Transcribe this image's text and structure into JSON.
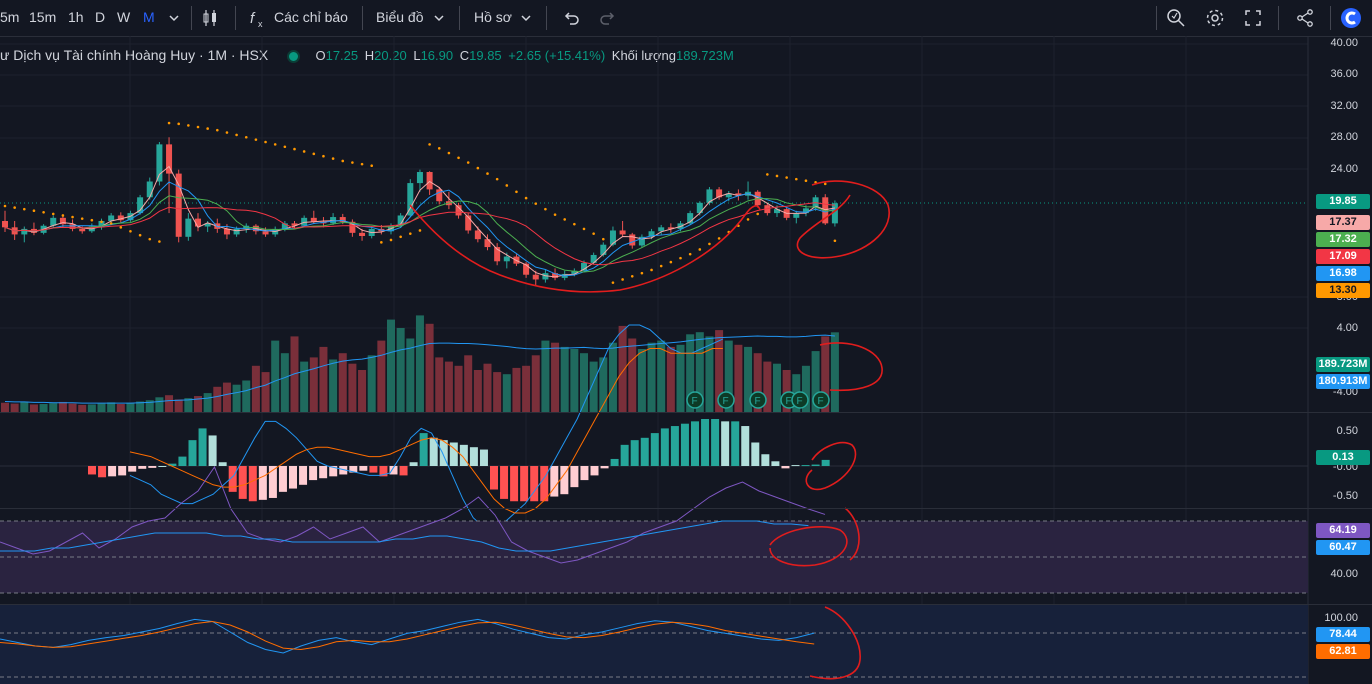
{
  "toolbar": {
    "intervals": [
      "5m",
      "15m",
      "1h",
      "D",
      "W",
      "M"
    ],
    "active_interval": "M",
    "indicators_label": "Các chỉ báo",
    "chart_label": "Biểu đồ",
    "profile_label": "Hồ sơ"
  },
  "legend": {
    "symbol": "ư Dịch vụ Tài chính Hoàng Huy · 1M · HSX",
    "o_label": "O",
    "o_value": "17.25",
    "h_label": "H",
    "h_value": "20.20",
    "l_label": "L",
    "l_value": "16.90",
    "c_label": "C",
    "c_value": "19.85",
    "change": "+2.65 (+15.41%)",
    "volume_label": "Khối lượng",
    "volume_value": "189.723M"
  },
  "price_axis": [
    "40.00",
    "36.00",
    "32.00",
    "28.00",
    "24.00",
    "8.00",
    "4.00",
    "-4.00"
  ],
  "price_tags": [
    {
      "value": "19.85",
      "bg": "#089981",
      "fg": "#ffffff"
    },
    {
      "value": "17.37",
      "bg": "#f7a9a8",
      "fg": "#131722"
    },
    {
      "value": "17.32",
      "bg": "#4caf50",
      "fg": "#ffffff"
    },
    {
      "value": "17.09",
      "bg": "#f23645",
      "fg": "#ffffff"
    },
    {
      "value": "16.98",
      "bg": "#2196f3",
      "fg": "#ffffff"
    },
    {
      "value": "13.30",
      "bg": "#ff9800",
      "fg": "#131722"
    }
  ],
  "volume_tags": [
    {
      "value": "189.723M",
      "bg": "#089981",
      "fg": "#ffffff"
    },
    {
      "value": "180.913M",
      "bg": "#2196f3",
      "fg": "#ffffff"
    }
  ],
  "macd_axis": [
    "0.50",
    "-0.00",
    "-0.50"
  ],
  "macd_tag": {
    "value": "0.13",
    "bg": "#089981",
    "fg": "#ffffff"
  },
  "rsi_axis": [
    "40.00"
  ],
  "rsi_tags": [
    {
      "value": "64.19",
      "bg": "#7e57c2",
      "fg": "#ffffff"
    },
    {
      "value": "60.47",
      "bg": "#2196f3",
      "fg": "#ffffff"
    }
  ],
  "stoch_axis": [
    "100.00"
  ],
  "stoch_tags": [
    {
      "value": "78.44",
      "bg": "#2196f3",
      "fg": "#ffffff"
    },
    {
      "value": "62.81",
      "bg": "#ff6d00",
      "fg": "#ffffff"
    }
  ],
  "event_marker": "F",
  "colors": {
    "up": "#26a69a",
    "down": "#ef5350",
    "vol_up": "#1f6a5e",
    "vol_down": "#7a2f3a",
    "accent": "#2962ff"
  },
  "chart_data": {
    "type": "candlestick",
    "candles": [
      [
        17.6,
        18.9,
        16.2,
        16.8
      ],
      [
        16.8,
        17.6,
        15.2,
        15.9
      ],
      [
        15.9,
        16.9,
        14.9,
        16.6
      ],
      [
        16.6,
        17.4,
        15.8,
        16.1
      ],
      [
        16.1,
        17.2,
        15.9,
        17.0
      ],
      [
        17.0,
        18.3,
        16.7,
        18.0
      ],
      [
        18.0,
        18.2,
        16.8,
        17.2
      ],
      [
        17.2,
        17.8,
        16.3,
        16.6
      ],
      [
        16.6,
        16.9,
        16.0,
        16.3
      ],
      [
        16.3,
        17.3,
        16.1,
        16.9
      ],
      [
        16.9,
        17.9,
        16.5,
        17.6
      ],
      [
        17.6,
        18.6,
        17.2,
        18.3
      ],
      [
        18.3,
        18.7,
        17.3,
        17.7
      ],
      [
        17.7,
        18.9,
        17.5,
        18.6
      ],
      [
        18.6,
        20.9,
        18.4,
        20.6
      ],
      [
        20.6,
        23.1,
        20.3,
        22.6
      ],
      [
        22.6,
        27.6,
        22.1,
        27.3
      ],
      [
        27.3,
        28.2,
        18.6,
        23.6
      ],
      [
        23.6,
        24.1,
        14.9,
        15.6
      ],
      [
        15.6,
        18.6,
        15.1,
        17.9
      ],
      [
        17.9,
        18.6,
        16.3,
        16.9
      ],
      [
        16.9,
        17.6,
        16.2,
        17.3
      ],
      [
        17.3,
        17.9,
        16.1,
        16.6
      ],
      [
        16.6,
        17.2,
        15.3,
        15.9
      ],
      [
        15.9,
        16.9,
        15.6,
        16.6
      ],
      [
        16.6,
        17.3,
        16.1,
        17.0
      ],
      [
        17.0,
        17.2,
        15.9,
        16.3
      ],
      [
        16.3,
        16.8,
        15.6,
        15.9
      ],
      [
        15.9,
        16.9,
        15.6,
        16.6
      ],
      [
        16.6,
        17.6,
        16.3,
        17.3
      ],
      [
        17.3,
        17.6,
        16.6,
        17.0
      ],
      [
        17.0,
        18.3,
        16.8,
        18.0
      ],
      [
        18.0,
        18.9,
        17.3,
        17.5
      ],
      [
        17.5,
        18.1,
        16.8,
        17.3
      ],
      [
        17.3,
        18.6,
        17.1,
        18.1
      ],
      [
        18.1,
        18.5,
        17.2,
        17.5
      ],
      [
        17.5,
        17.8,
        15.6,
        16.1
      ],
      [
        16.1,
        16.6,
        15.1,
        15.7
      ],
      [
        15.7,
        16.9,
        15.4,
        16.6
      ],
      [
        16.6,
        17.1,
        15.9,
        16.3
      ],
      [
        16.3,
        17.3,
        15.9,
        17.0
      ],
      [
        17.0,
        18.6,
        16.8,
        18.3
      ],
      [
        18.3,
        22.9,
        18.1,
        22.4
      ],
      [
        22.4,
        24.1,
        21.3,
        23.8
      ],
      [
        23.8,
        23.9,
        20.9,
        21.6
      ],
      [
        21.6,
        21.9,
        19.7,
        20.1
      ],
      [
        20.1,
        21.3,
        19.1,
        19.6
      ],
      [
        19.6,
        19.9,
        17.9,
        18.3
      ],
      [
        18.3,
        18.6,
        16.0,
        16.4
      ],
      [
        16.4,
        16.9,
        14.9,
        15.3
      ],
      [
        15.3,
        15.9,
        13.9,
        14.3
      ],
      [
        14.3,
        14.8,
        12.0,
        12.5
      ],
      [
        12.5,
        13.6,
        11.6,
        13.1
      ],
      [
        13.1,
        13.4,
        11.9,
        12.2
      ],
      [
        12.2,
        12.4,
        10.4,
        10.8
      ],
      [
        10.8,
        11.3,
        9.5,
        10.2
      ],
      [
        10.2,
        11.4,
        9.8,
        11.0
      ],
      [
        11.0,
        11.6,
        10.1,
        10.4
      ],
      [
        10.4,
        11.3,
        10.1,
        10.9
      ],
      [
        10.9,
        11.6,
        10.6,
        11.3
      ],
      [
        11.3,
        12.6,
        11.1,
        12.3
      ],
      [
        12.3,
        13.6,
        12.1,
        13.3
      ],
      [
        13.3,
        14.9,
        13.1,
        14.6
      ],
      [
        14.6,
        16.9,
        14.4,
        16.4
      ],
      [
        16.4,
        17.6,
        15.6,
        15.9
      ],
      [
        15.9,
        16.1,
        14.1,
        14.5
      ],
      [
        14.5,
        15.9,
        14.2,
        15.6
      ],
      [
        15.6,
        16.6,
        15.3,
        16.3
      ],
      [
        16.3,
        17.1,
        15.8,
        16.8
      ],
      [
        16.8,
        17.3,
        16.1,
        16.6
      ],
      [
        16.6,
        17.6,
        16.3,
        17.3
      ],
      [
        17.3,
        18.9,
        17.1,
        18.6
      ],
      [
        18.6,
        20.1,
        18.3,
        19.9
      ],
      [
        19.9,
        21.9,
        19.6,
        21.6
      ],
      [
        21.6,
        21.9,
        20.3,
        20.6
      ],
      [
        20.6,
        21.4,
        20.1,
        21.1
      ],
      [
        21.1,
        21.6,
        20.2,
        20.8
      ],
      [
        20.8,
        22.6,
        20.3,
        21.3
      ],
      [
        21.3,
        21.5,
        19.3,
        19.6
      ],
      [
        19.6,
        19.9,
        18.3,
        18.6
      ],
      [
        18.6,
        19.6,
        18.1,
        19.1
      ],
      [
        19.1,
        19.3,
        17.7,
        18.0
      ],
      [
        18.0,
        18.9,
        17.3,
        18.6
      ],
      [
        18.6,
        19.6,
        18.2,
        19.2
      ],
      [
        19.2,
        20.9,
        18.9,
        20.6
      ],
      [
        20.6,
        21.0,
        17.1,
        17.3
      ],
      [
        17.3,
        20.2,
        16.9,
        19.85
      ]
    ],
    "psar": [
      19.5,
      19.3,
      19.1,
      18.9,
      18.7,
      18.5,
      18.3,
      18.1,
      17.9,
      17.7,
      17.5,
      17.3,
      16.8,
      16.3,
      15.8,
      15.3,
      15.0,
      30.0,
      29.9,
      29.7,
      29.5,
      29.3,
      29.1,
      28.8,
      28.5,
      28.2,
      27.9,
      27.6,
      27.3,
      27.0,
      26.7,
      26.4,
      26.1,
      25.8,
      25.5,
      25.2,
      25.0,
      24.8,
      24.6,
      14.9,
      15.2,
      15.6,
      16.0,
      16.4,
      27.3,
      26.8,
      26.2,
      25.6,
      25.0,
      24.3,
      23.6,
      22.9,
      22.1,
      21.3,
      20.5,
      19.8,
      19.1,
      18.4,
      17.8,
      17.2,
      16.6,
      16.0,
      15.3,
      9.8,
      10.2,
      10.6,
      11.0,
      11.4,
      11.9,
      12.4,
      12.9,
      13.4,
      14.0,
      14.7,
      15.4,
      16.2,
      17.0,
      17.8,
      18.5,
      23.5,
      23.3,
      23.1,
      22.9,
      22.7,
      22.5,
      22.3,
      15.1
    ],
    "volume_M": [
      22,
      20,
      25,
      18,
      19,
      21,
      24,
      20,
      17,
      18,
      20,
      23,
      19,
      22,
      25,
      28,
      35,
      40,
      30,
      33,
      38,
      45,
      60,
      70,
      65,
      75,
      110,
      95,
      170,
      140,
      180,
      120,
      130,
      155,
      125,
      140,
      115,
      100,
      135,
      170,
      220,
      200,
      175,
      230,
      210,
      130,
      120,
      110,
      135,
      100,
      115,
      95,
      90,
      105,
      110,
      135,
      170,
      165,
      155,
      150,
      140,
      120,
      130,
      165,
      205,
      175,
      150,
      165,
      170,
      155,
      160,
      185,
      190,
      180,
      195,
      170,
      160,
      155,
      140,
      120,
      115,
      100,
      90,
      110,
      145,
      180,
      189.723
    ],
    "volume_ma_M": [
      25,
      24,
      24,
      23,
      23,
      22,
      22,
      22,
      21,
      21,
      21,
      21,
      21,
      21,
      22,
      23,
      25,
      27,
      28,
      29,
      31,
      33,
      37,
      42,
      46,
      51,
      58,
      64,
      74,
      82,
      91,
      97,
      103,
      110,
      116,
      121,
      124,
      126,
      130,
      135,
      142,
      148,
      152,
      158,
      163,
      164,
      164,
      163,
      163,
      162,
      160,
      158,
      156,
      153,
      151,
      150,
      151,
      152,
      152,
      153,
      154,
      152,
      151,
      152,
      155,
      157,
      159,
      161,
      163,
      165,
      167,
      170,
      173,
      175,
      177,
      178,
      179,
      180,
      181,
      180,
      180,
      179,
      179,
      180,
      182,
      183,
      180.913
    ],
    "macd": {
      "histogram": [
        -0.18,
        -0.24,
        -0.22,
        -0.2,
        -0.12,
        -0.06,
        -0.04,
        0.0,
        0.05,
        0.2,
        0.55,
        0.8,
        0.65,
        0.08,
        -0.55,
        -0.7,
        -0.75,
        -0.72,
        -0.68,
        -0.55,
        -0.48,
        -0.4,
        -0.3,
        -0.26,
        -0.22,
        -0.18,
        -0.14,
        -0.1,
        -0.14,
        -0.22,
        -0.18,
        -0.2,
        0.08,
        0.7,
        0.6,
        0.55,
        0.5,
        0.45,
        0.4,
        0.35,
        -0.5,
        -0.7,
        -0.75,
        -0.75,
        -0.75,
        -0.75,
        -0.65,
        -0.6,
        -0.45,
        -0.3,
        -0.2,
        -0.05,
        0.15,
        0.45,
        0.55,
        0.6,
        0.7,
        0.8,
        0.85,
        0.9,
        0.95,
        1.0,
        1.0,
        0.95,
        0.95,
        0.85,
        0.5,
        0.25,
        0.1,
        -0.05,
        0.02,
        0.02,
        0.03,
        0.13
      ],
      "macd_line": [
        -0.2,
        -0.3,
        -0.4,
        -0.6,
        -0.7,
        -0.8,
        -0.8,
        -0.7,
        -0.6,
        -0.4,
        -0.2,
        0.2,
        0.6,
        0.95,
        0.95,
        0.8,
        0.6,
        0.35,
        0.1,
        0.0,
        -0.05,
        -0.1,
        -0.15,
        -0.2,
        -0.2,
        -0.15,
        0.2,
        0.6,
        0.8,
        0.7,
        0.3,
        -0.2,
        -0.7,
        -1.1,
        -1.3,
        -1.3,
        -1.2,
        -1.0,
        -0.8,
        -0.5,
        -0.2,
        0.2,
        0.6,
        1.0,
        1.5,
        2.0,
        2.5,
        2.8,
        3.0,
        3.0,
        2.9,
        2.7,
        2.5,
        2.4,
        2.4,
        2.5,
        2.6,
        2.7
      ],
      "signal_line": [
        0.3,
        0.25,
        0.2,
        0.1,
        0.0,
        -0.1,
        -0.2,
        -0.3,
        -0.4,
        -0.45,
        -0.45,
        -0.4,
        -0.3,
        -0.2,
        -0.05,
        0.1,
        0.25,
        0.35,
        0.4,
        0.4,
        0.35,
        0.3,
        0.25,
        0.2,
        0.2,
        0.25,
        0.35,
        0.45,
        0.55,
        0.6,
        0.55,
        0.4,
        0.2,
        -0.1,
        -0.4,
        -0.7,
        -0.9,
        -1.0,
        -1.0,
        -0.9,
        -0.7,
        -0.4,
        -0.1,
        0.3,
        0.7,
        1.1,
        1.5,
        1.9,
        2.2,
        2.4,
        2.5,
        2.5,
        2.4,
        2.4,
        2.4,
        2.4,
        2.5,
        2.5
      ]
    },
    "rsi": [
      55,
      53,
      51,
      52,
      55,
      58,
      53,
      56,
      60,
      62,
      63,
      68,
      72,
      80,
      66,
      58,
      56,
      55,
      57,
      60,
      56,
      58,
      60,
      55,
      57,
      59,
      61,
      63,
      66,
      70,
      64,
      55,
      52,
      50,
      48,
      49,
      51,
      53,
      55,
      58,
      60,
      62,
      66,
      70,
      73,
      75,
      72,
      70,
      68,
      66,
      64.19
    ],
    "rsi_ma": [
      52,
      52,
      52,
      53,
      53,
      54,
      55,
      56,
      57,
      58,
      58,
      58,
      58,
      57,
      57,
      56,
      56,
      55,
      55,
      55,
      55,
      55,
      55,
      56,
      56,
      57,
      57,
      56,
      55,
      53,
      52,
      52,
      52,
      53,
      54,
      55,
      56,
      57,
      58,
      59,
      60,
      61,
      62,
      62,
      62,
      61,
      61,
      60.47
    ],
    "stochastic_k": [
      70,
      65,
      60,
      58,
      62,
      68,
      72,
      75,
      80,
      85,
      92,
      98,
      95,
      80,
      65,
      55,
      50,
      60,
      68,
      72,
      66,
      62,
      70,
      78,
      82,
      88,
      94,
      98,
      92,
      84,
      78,
      72,
      70,
      76,
      80,
      86,
      92,
      96,
      94,
      88,
      82,
      78,
      74,
      70,
      68,
      72,
      78.44
    ],
    "stochastic_d": [
      65,
      63,
      60,
      58,
      59,
      63,
      67,
      71,
      75,
      80,
      86,
      92,
      95,
      90,
      80,
      67,
      57,
      55,
      59,
      66,
      68,
      66,
      66,
      70,
      76,
      82,
      88,
      93,
      94,
      90,
      84,
      78,
      73,
      72,
      75,
      80,
      86,
      91,
      94,
      92,
      88,
      82,
      78,
      74,
      70,
      66,
      62.81
    ]
  }
}
